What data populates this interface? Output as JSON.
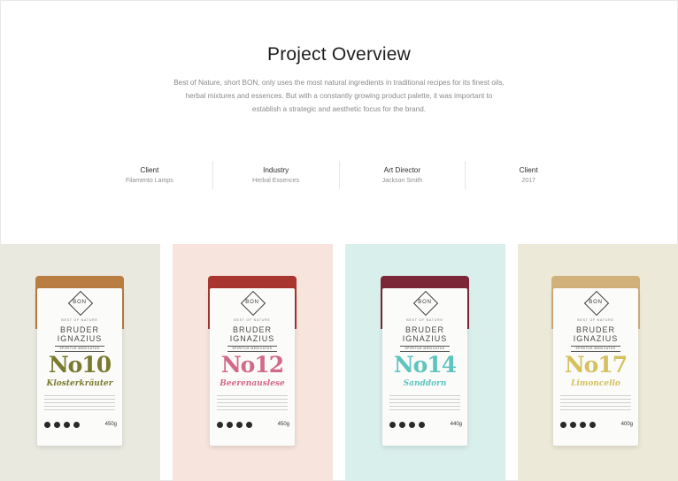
{
  "section": {
    "title": "Project Overview",
    "description": "Best of Nature, short BON, only uses the most natural ingredients in traditional recipes for its finest oils, herbal mixtures and essences. But with a constantly growing product palette, it was important to establish a strategic and aesthetic focus for the brand."
  },
  "meta": [
    {
      "label": "Client",
      "value": "Filamento Lamps"
    },
    {
      "label": "Industry",
      "value": "Herbal Essences"
    },
    {
      "label": "Art Director",
      "value": "Jackson Smith"
    },
    {
      "label": "Client",
      "value": "2017"
    }
  ],
  "products": [
    {
      "brand": "BON",
      "tagline": "BEST OF NATURE",
      "name": "BRUDER IGNAZIUS",
      "subtitle": "SPIRITUS MEDICATUS",
      "number": "No10",
      "variety": "Klosterkräuter",
      "weight": "450g",
      "background": "#e9e9e0",
      "accent": "#7a7a2f",
      "fill": "#b97d42"
    },
    {
      "brand": "BON",
      "tagline": "BEST OF NATURE",
      "name": "BRUDER IGNAZIUS",
      "subtitle": "SPIRITUS MEDICATUS",
      "number": "No12",
      "variety": "Beerenauslese",
      "weight": "450g",
      "background": "#f6e4dd",
      "accent": "#d2688a",
      "fill": "#a8352f"
    },
    {
      "brand": "BON",
      "tagline": "BEST OF NATURE",
      "name": "BRUDER IGNAZIUS",
      "subtitle": "SPIRITUS MEDICATUS",
      "number": "No14",
      "variety": "Sanddorn",
      "weight": "440g",
      "background": "#d9efeb",
      "accent": "#5fc4c0",
      "fill": "#7b2737"
    },
    {
      "brand": "BON",
      "tagline": "BEST OF NATURE",
      "name": "BRUDER IGNAZIUS",
      "subtitle": "SPIRITUS MEDICATUS",
      "number": "No17",
      "variety": "Limoncello",
      "weight": "400g",
      "background": "#ece9d8",
      "accent": "#d6c15e",
      "fill": "#d2b07a"
    }
  ]
}
